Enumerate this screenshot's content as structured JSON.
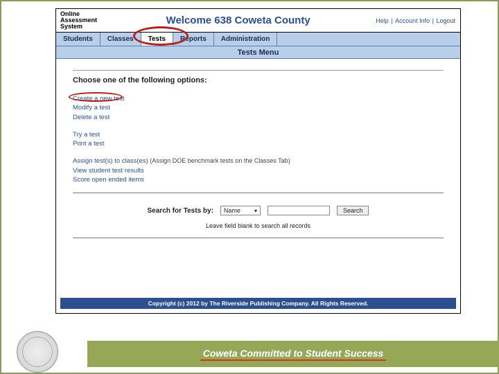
{
  "header": {
    "logo_line1": "Online",
    "logo_line2": "Assessment",
    "logo_line3": "System",
    "welcome": "Welcome 638 Coweta County",
    "help": "Help",
    "account_info": "Account Info",
    "logout": "Logout"
  },
  "nav": {
    "students": "Students",
    "classes": "Classes",
    "tests": "Tests",
    "reports": "Reports",
    "administration": "Administration"
  },
  "submenu_title": "Tests Menu",
  "choose_header": "Choose one of the following options:",
  "groups": {
    "g1": {
      "create": "Create a new test",
      "modify": "Modify a test",
      "delete": "Delete a test"
    },
    "g2": {
      "try": "Try a test",
      "print": "Print a test"
    },
    "g3": {
      "assign": "Assign test(s) to class(es)",
      "assign_hint": "(Assign DOE benchmark tests on the Classes Tab)",
      "view": "View student test results",
      "score": "Score open ended items"
    }
  },
  "search": {
    "label": "Search for Tests by:",
    "select_value": "Name",
    "button": "Search"
  },
  "leave_blank": "Leave field blank to search all records",
  "copyright": "Copyright (c) 2012 by The Riverside Publishing Company. All Rights Reserved.",
  "slide_footer": "Coweta Committed to Student Success"
}
